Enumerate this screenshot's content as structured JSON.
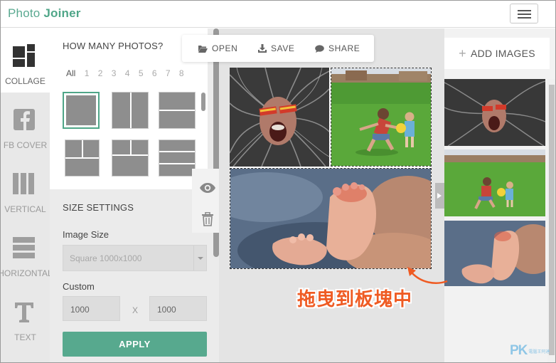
{
  "app": {
    "logo_word1": "Photo",
    "logo_word2": "Joiner"
  },
  "sidebar": {
    "items": [
      {
        "label": "COLLAGE",
        "icon": "collage-icon",
        "active": true
      },
      {
        "label": "FB COVER",
        "icon": "facebook-icon",
        "active": false
      },
      {
        "label": "VERTICAL",
        "icon": "vertical-icon",
        "active": false
      },
      {
        "label": "HORIZONTAL",
        "icon": "horizontal-icon",
        "active": false
      },
      {
        "label": "TEXT",
        "icon": "text-icon",
        "active": false
      }
    ]
  },
  "panel": {
    "photos_title": "HOW MANY PHOTOS?",
    "counts": [
      "All",
      "1",
      "2",
      "3",
      "4",
      "5",
      "6",
      "7",
      "8"
    ],
    "size_title": "SIZE SETTINGS",
    "image_size_label": "Image Size",
    "image_size_value": "Square 1000x1000",
    "custom_label": "Custom",
    "width_value": "1000",
    "times": "X",
    "height_value": "1000",
    "apply_label": "APPLY"
  },
  "toolbar": {
    "open": "OPEN",
    "save": "SAVE",
    "share": "SHARE"
  },
  "right": {
    "add_images": "ADD IMAGES",
    "add_symbol": "+"
  },
  "annotation": {
    "text": "拖曳到板塊中",
    "color": "#ef5b23"
  },
  "watermark": {
    "main": "PK",
    "sub": "電腦王阿達"
  },
  "colors": {
    "accent": "#57a98e",
    "logo": "#5aa990",
    "annotation": "#ef5b23"
  }
}
